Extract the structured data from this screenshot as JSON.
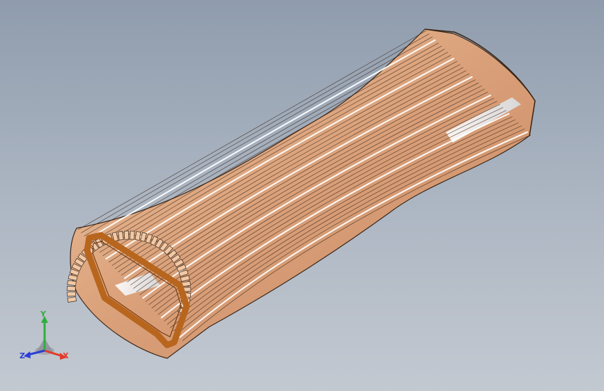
{
  "viewport": {
    "background_top": "#8f9cad",
    "background_bottom": "#c3c9d1"
  },
  "model": {
    "description_icon": "wooden-slat-tube-model-icon",
    "slat_color": "#d8a07c",
    "slat_highlight": "#f1c9a6",
    "edge_color": "#3a2618",
    "frame_color": "#b8661e",
    "gap_color": "#ffffff",
    "slat_count": 34
  },
  "triad": {
    "x_label": "X",
    "y_label": "Y",
    "z_label": "Z",
    "x_color": "#e23a2a",
    "y_color": "#2fae3b",
    "z_color": "#2a3fd6"
  }
}
